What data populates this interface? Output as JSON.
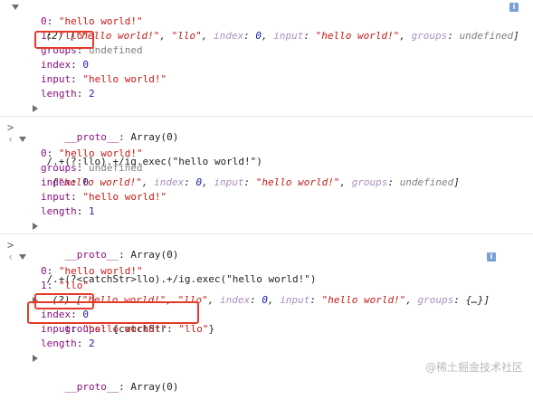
{
  "block1": {
    "summary": {
      "count": "(2)",
      "open": "[",
      "val0": "\"hello world!\"",
      "comma1": ", ",
      "val1": "\"llo\"",
      "comma2": ", ",
      "index_key": "index",
      "colon1": ": ",
      "index_val": "0",
      "comma3": ", ",
      "input_key": "input",
      "colon2": ": ",
      "input_val": "\"hello world!\"",
      "comma4": ", ",
      "groups_key": "groups",
      "colon3": ": ",
      "groups_val": "undefined",
      "close": "]"
    },
    "props": [
      {
        "key": "0",
        "value": "\"hello world!\""
      },
      {
        "key": "1",
        "value": "\"llo\""
      },
      {
        "key": "groups",
        "value": "undefined"
      },
      {
        "key": "index",
        "value": "0"
      },
      {
        "key": "input",
        "value": "\"hello world!\""
      },
      {
        "key": "length",
        "value": "2"
      },
      {
        "key": "__proto__",
        "value": "Array(0)"
      }
    ]
  },
  "command2": "/.+(?:llo).+/ig.exec(\"hello world!\")",
  "block2": {
    "summary": {
      "open": "[",
      "val0": "\"hello world!\"",
      "comma1": ", ",
      "index_key": "index",
      "colon1": ": ",
      "index_val": "0",
      "comma2": ", ",
      "input_key": "input",
      "colon2": ": ",
      "input_val": "\"hello world!\"",
      "comma3": ", ",
      "groups_key": "groups",
      "colon3": ": ",
      "groups_val": "undefined",
      "close": "]"
    },
    "props": [
      {
        "key": "0",
        "value": "\"hello world!\""
      },
      {
        "key": "groups",
        "value": "undefined"
      },
      {
        "key": "index",
        "value": "0"
      },
      {
        "key": "input",
        "value": "\"hello world!\""
      },
      {
        "key": "length",
        "value": "1"
      },
      {
        "key": "__proto__",
        "value": "Array(0)"
      }
    ]
  },
  "command3": "/.+(?<catchStr>llo).+/ig.exec(\"hello world!\")",
  "block3": {
    "summary": {
      "count": "(2)",
      "open": "[",
      "val0": "\"hello world!\"",
      "comma1": ", ",
      "val1": "\"llo\"",
      "comma2": ", ",
      "index_key": "index",
      "colon1": ": ",
      "index_val": "0",
      "comma3": ", ",
      "input_key": "input",
      "colon2": ": ",
      "input_val": "\"hello world!\"",
      "comma4": ", ",
      "groups_key": "groups",
      "colon3": ": ",
      "groups_val": "{…}",
      "close": "]"
    },
    "props": [
      {
        "key": "0",
        "value": "\"hello world!\""
      },
      {
        "key": "1",
        "value": "\"llo\""
      },
      {
        "key": "groups",
        "value": "{catchStr: ",
        "value_str": "\"llo\"",
        "value_end": "}"
      },
      {
        "key": "index",
        "value": "0"
      },
      {
        "key": "input",
        "value": "\"hello world!\""
      },
      {
        "key": "length",
        "value": "2"
      },
      {
        "key": "__proto__",
        "value": "Array(0)"
      }
    ]
  },
  "info_glyph": "i",
  "prompt_glyph": ">",
  "result_glyph": "‹",
  "watermark": "@稀土掘金技术社区",
  "colors": {
    "highlight_box": "#e53b2a",
    "key": "#881280",
    "string": "#c41a16",
    "number": "#1a1aa6",
    "undefined": "#808080"
  },
  "icons": [
    "expand-triangle-down-icon",
    "expand-triangle-right-icon",
    "info-icon",
    "prompt-chevron-icon",
    "result-chevron-icon"
  ]
}
